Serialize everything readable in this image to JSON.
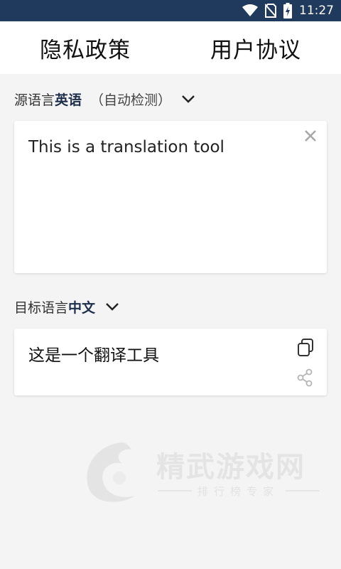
{
  "status_bar": {
    "time": "11:27",
    "icons": [
      "wifi-icon",
      "no-sim-icon",
      "battery-charging-icon"
    ]
  },
  "top_nav": {
    "privacy_policy": "隐私政策",
    "user_agreement": "用户协议"
  },
  "source": {
    "label": "源语言",
    "language": "英语",
    "detect_note": "（自动检测）",
    "text": "This is a translation tool"
  },
  "target": {
    "label": "目标语言",
    "language": "中文",
    "text": "这是一个翻译工具"
  },
  "watermark": {
    "brand": "精武游戏网",
    "tagline": "排行榜专家"
  },
  "colors": {
    "status_bar_bg": "#1f3a5c",
    "page_bg": "#f4f4f4",
    "language_accent": "#1d2f4a",
    "icon_gray": "#9a9a9a"
  }
}
